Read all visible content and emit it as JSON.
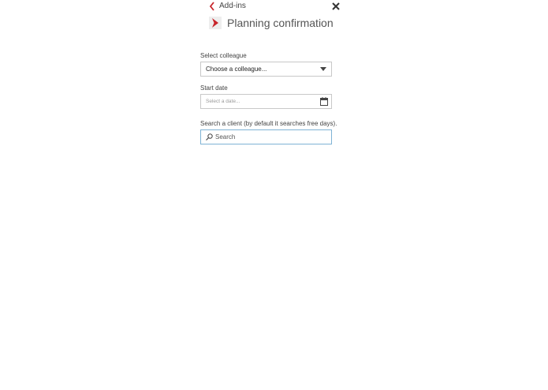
{
  "header": {
    "back_label": "Add-ins",
    "title": "Planning confirmation"
  },
  "form": {
    "colleague": {
      "label": "Select colleague",
      "selected": "Choose a colleague..."
    },
    "start_date": {
      "label": "Start date",
      "placeholder": "Select a date..."
    },
    "search": {
      "label": "Search a client (by default it searches free days).",
      "placeholder": "Search"
    }
  },
  "icons": {
    "back": "chevron-left-icon",
    "close": "close-icon",
    "logo": "app-logo-icon",
    "dropdown": "chevron-down-icon",
    "calendar": "calendar-icon",
    "search": "search-icon"
  },
  "colors": {
    "accent": "#c8262c",
    "focus_border": "#7fb3d5"
  }
}
